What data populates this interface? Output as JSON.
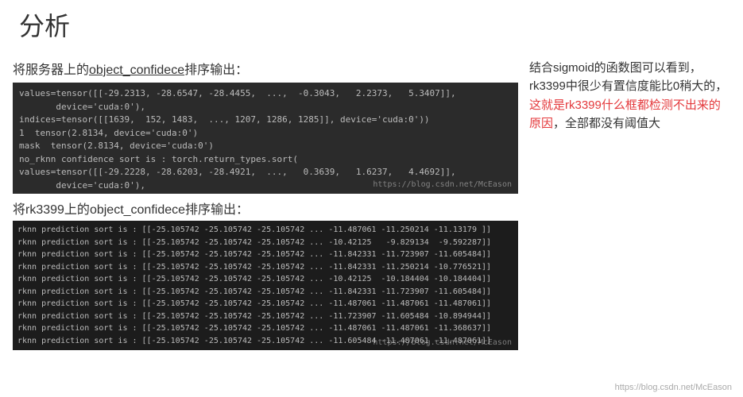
{
  "title": "分析",
  "section1_label_pre": "将服务器上的",
  "section1_label_u": "object_confidece",
  "section1_label_post": "排序输出：",
  "code1": "values=tensor([[-29.2313, -28.6547, -28.4455,  ...,  -0.3043,   2.2373,   5.3407]],\n       device='cuda:0'),\nindices=tensor([[1639,  152, 1483,  ..., 1207, 1286, 1285]], device='cuda:0'))\n1  tensor(2.8134, device='cuda:0')\nmask  tensor(2.8134, device='cuda:0')\nno_rknn confidence sort is : torch.return_types.sort(\nvalues=tensor([[-29.2228, -28.6203, -28.4921,  ...,   0.3639,   1.6237,   4.4692]],\n       device='cuda:0'),",
  "watermark1": "https://blog.csdn.net/McEason",
  "section2_label_pre": "将rk3399上的",
  "section2_label_u": "object_confidece",
  "section2_label_post": "排序输出：",
  "code2": "rknn prediction sort is : [[-25.105742 -25.105742 -25.105742 ... -11.487061 -11.250214 -11.13179 ]]\nrknn prediction sort is : [[-25.105742 -25.105742 -25.105742 ... -10.42125   -9.829134  -9.592287]]\nrknn prediction sort is : [[-25.105742 -25.105742 -25.105742 ... -11.842331 -11.723907 -11.605484]]\nrknn prediction sort is : [[-25.105742 -25.105742 -25.105742 ... -11.842331 -11.250214 -10.776521]]\nrknn prediction sort is : [[-25.105742 -25.105742 -25.105742 ... -10.42125  -10.184404 -10.184404]]\nrknn prediction sort is : [[-25.105742 -25.105742 -25.105742 ... -11.842331 -11.723907 -11.605484]]\nrknn prediction sort is : [[-25.105742 -25.105742 -25.105742 ... -11.487061 -11.487061 -11.487061]]\nrknn prediction sort is : [[-25.105742 -25.105742 -25.105742 ... -11.723907 -11.605484 -10.894944]]\nrknn prediction sort is : [[-25.105742 -25.105742 -25.105742 ... -11.487061 -11.487061 -11.368637]]\nrknn prediction sort is : [[-25.105742 -25.105742 -25.105742 ... -11.605484 -11.487061 -11.487061]]",
  "watermark2": "https://blog.csdn.net/McEason",
  "right_p1": "结合sigmoid的函数图可以看到，rk3399中很少有置信度能比0稍大的，",
  "right_red": "这就是rk3399什么框都检测不出来的原因",
  "right_p2": "，全部都没有阈值大",
  "page_watermark": "https://blog.csdn.net/McEason"
}
